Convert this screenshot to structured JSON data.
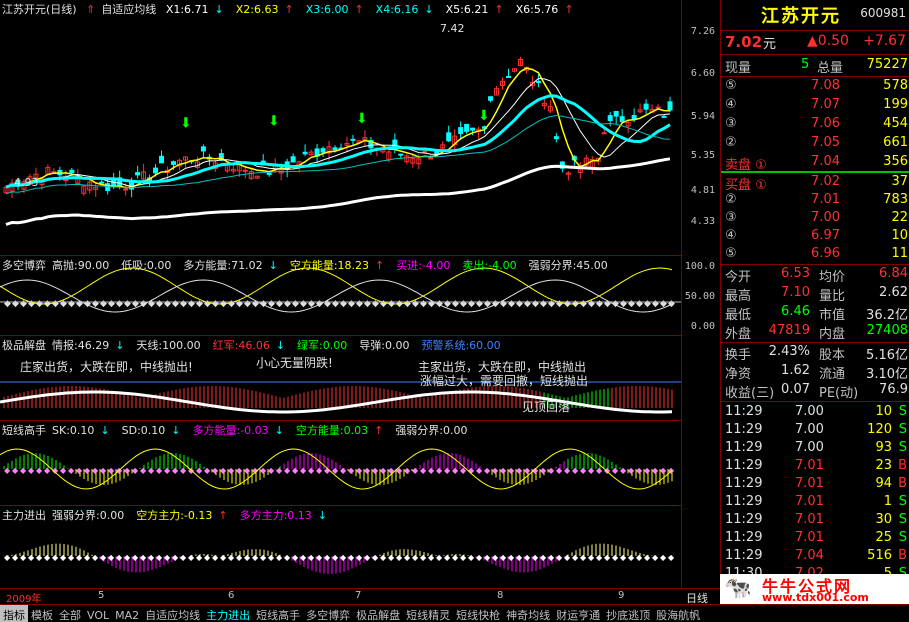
{
  "stock": {
    "name": "江苏开元",
    "code": "600981"
  },
  "main": {
    "title": "江苏开元(日线)",
    "indicator": "自适应均线",
    "ma": [
      {
        "label": "X1:6.71",
        "arrow": "↓",
        "color": "#ffffff"
      },
      {
        "label": "X2:6.63",
        "arrow": "↑",
        "color": "#ffff00"
      },
      {
        "label": "X3:6.00",
        "arrow": "↑",
        "color": "#00ffff"
      },
      {
        "label": "X4:6.16",
        "arrow": "↓",
        "color": "#00ffff"
      },
      {
        "label": "X5:6.21",
        "arrow": "↑",
        "color": "#ffffff"
      },
      {
        "label": "X6:5.76",
        "arrow": "↑",
        "color": "#ffffff"
      }
    ],
    "high_label": "7.42",
    "low_label": "4.93",
    "yticks": [
      "7.26",
      "6.60",
      "5.94",
      "5.35",
      "4.81",
      "4.33"
    ]
  },
  "panel1": {
    "title": "多空博弈",
    "items": [
      "高抛:90.00",
      "低吸:0.00",
      "多方能量:71.02",
      "空方能量:18.23",
      "买进:-4.00",
      "卖出:-4.00",
      "强弱分界:45.00"
    ],
    "arrows": [
      "",
      "",
      "↓",
      "↑",
      "",
      "",
      ""
    ],
    "yticks": [
      "100.0",
      "50.00",
      "0.00"
    ]
  },
  "panel2": {
    "title": "极品解盘",
    "items": [
      "情报:46.29",
      "天线:100.00",
      "红军:46.06",
      "绿军:0.00",
      "导弹:0.00",
      "预警系统:60.00"
    ],
    "arrows": [
      "↓",
      "",
      "↓",
      "",
      "",
      ""
    ],
    "notes": [
      "庄家出货，大跌在即，中线抛出!",
      "见顶回落",
      "主家出货，大跌在即，中线抛出",
      "小心无量阴跌!",
      "涨幅过大，需要回撤，短线抛出"
    ]
  },
  "panel3": {
    "title": "短线高手",
    "items": [
      "SK:0.10",
      "SD:0.10",
      "多方能量:-0.03",
      "空方能量:0.03",
      "强弱分界:0.00"
    ],
    "arrows": [
      "↓",
      "↓",
      "↓",
      "↑",
      ""
    ]
  },
  "panel4": {
    "title": "主力进出",
    "items": [
      "强弱分界:0.00",
      "空方主力:-0.13",
      "多方主力:0.13"
    ],
    "arrows": [
      "",
      "↑",
      "↓"
    ]
  },
  "xaxis": [
    "2009年",
    "5",
    "6",
    "7",
    "8",
    "9"
  ],
  "period": "日线",
  "quote": {
    "price": "7.02",
    "price_unit": "元",
    "change": "▲0.50",
    "change_pct": "+7.67",
    "now_label": "现量",
    "now_val": "5",
    "total_label": "总量",
    "total_val": "75227",
    "sell": [
      {
        "label": "⑤",
        "price": "7.08",
        "vol": "578"
      },
      {
        "label": "④",
        "price": "7.07",
        "vol": "199"
      },
      {
        "label": "③",
        "price": "7.06",
        "vol": "454"
      },
      {
        "label": "②",
        "price": "7.05",
        "vol": "661"
      },
      {
        "label": "卖盘 ①",
        "price": "7.04",
        "vol": "356"
      }
    ],
    "buy": [
      {
        "label": "买盘 ①",
        "price": "7.02",
        "vol": "37"
      },
      {
        "label": "②",
        "price": "7.01",
        "vol": "783"
      },
      {
        "label": "③",
        "price": "7.00",
        "vol": "22"
      },
      {
        "label": "④",
        "price": "6.97",
        "vol": "10"
      },
      {
        "label": "⑤",
        "price": "6.96",
        "vol": "11"
      }
    ],
    "stats": [
      {
        "a": "今开",
        "av": "6.53",
        "b": "均价",
        "bv": "6.84"
      },
      {
        "a": "最高",
        "av": "7.10",
        "b": "量比",
        "bv": "2.62"
      },
      {
        "a": "最低",
        "av": "6.46",
        "b": "市值",
        "bv": "36.2亿"
      },
      {
        "a": "外盘",
        "av": "47819",
        "b": "内盘",
        "bv": "27408"
      }
    ],
    "stats2": [
      {
        "a": "换手",
        "av": "2.43%",
        "b": "股本",
        "bv": "5.16亿"
      },
      {
        "a": "净资",
        "av": "1.62",
        "b": "流通",
        "bv": "3.10亿"
      },
      {
        "a": "收益(三)",
        "av": "0.07",
        "b": "PE(动)",
        "bv": "76.9"
      }
    ],
    "ticks": [
      {
        "t": "11:29",
        "p": "7.00",
        "v": "10",
        "s": "S"
      },
      {
        "t": "11:29",
        "p": "7.00",
        "v": "120",
        "s": "S"
      },
      {
        "t": "11:29",
        "p": "7.00",
        "v": "93",
        "s": "S"
      },
      {
        "t": "11:29",
        "p": "7.01",
        "v": "23",
        "s": "B"
      },
      {
        "t": "11:29",
        "p": "7.01",
        "v": "94",
        "s": "B"
      },
      {
        "t": "11:29",
        "p": "7.01",
        "v": "1",
        "s": "S"
      },
      {
        "t": "11:29",
        "p": "7.01",
        "v": "30",
        "s": "S"
      },
      {
        "t": "11:29",
        "p": "7.01",
        "v": "25",
        "s": "S"
      },
      {
        "t": "11:29",
        "p": "7.04",
        "v": "516",
        "s": "B"
      },
      {
        "t": "11:30",
        "p": "7.02",
        "v": "5",
        "s": "S"
      }
    ]
  },
  "logo": {
    "title": "牛牛公式网",
    "url": "www.tdx001.com"
  },
  "tabs": [
    "指标",
    "模板",
    "全部",
    "VOL",
    "MA2",
    "自适应均线",
    "主力进出",
    "短线高手",
    "多空博弈",
    "极品解盘",
    "短线精灵",
    "短线快枪",
    "神奇均线",
    "财运亨通",
    "抄底逃顶",
    "股海航帆"
  ],
  "colors": {
    "up": "#ff3030",
    "down": "#00ffff",
    "bg": "#000000",
    "grid": "#800000"
  }
}
